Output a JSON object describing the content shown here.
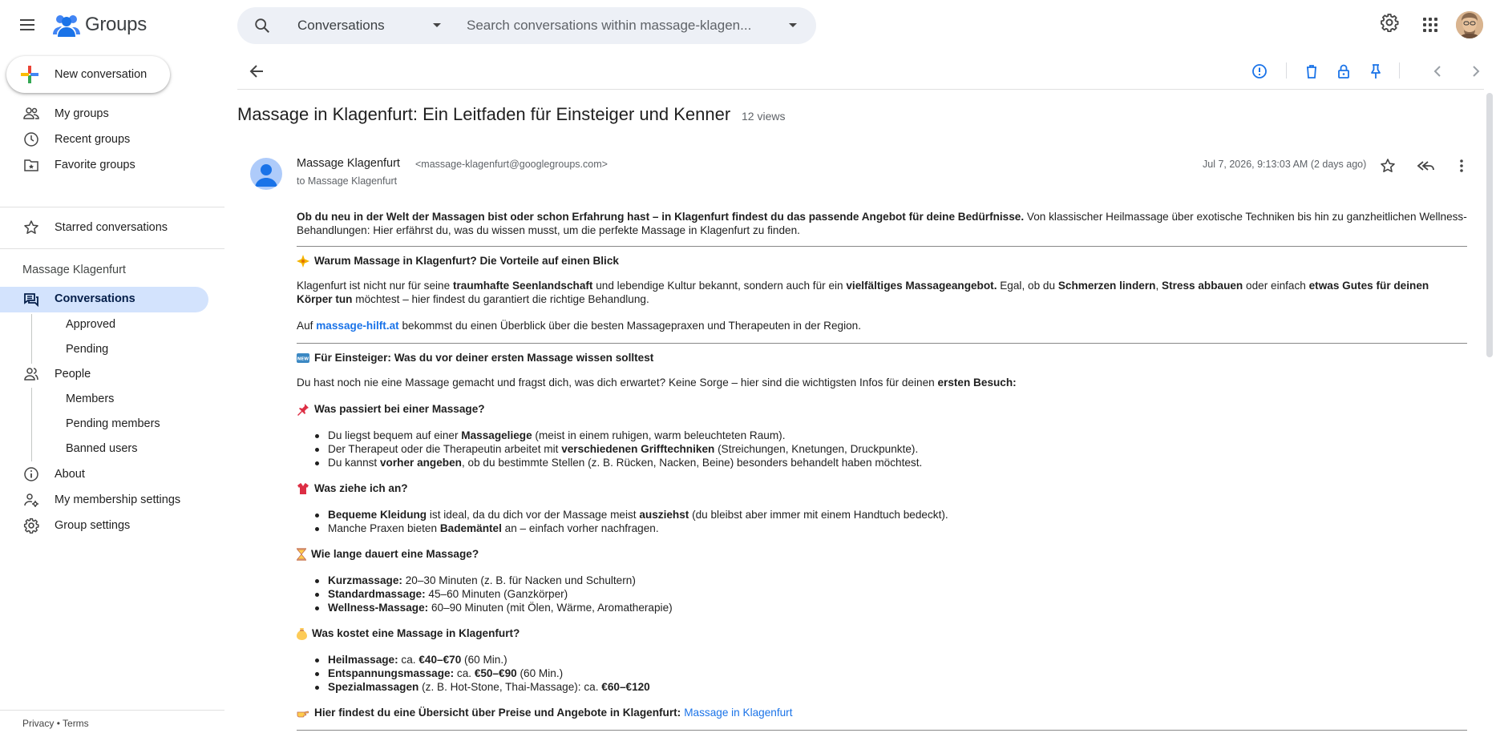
{
  "app": {
    "name": "Groups"
  },
  "search": {
    "scope": "Conversations",
    "placeholder": "Search conversations within massage-klagen..."
  },
  "sidebar": {
    "new_conversation": "New conversation",
    "top_items": [
      {
        "label": "My groups",
        "icon": "people-icon"
      },
      {
        "label": "Recent groups",
        "icon": "clock-icon"
      },
      {
        "label": "Favorite groups",
        "icon": "folder-star-icon"
      }
    ],
    "starred": "Starred conversations",
    "group_name": "Massage Klagenfurt",
    "conversations": "Conversations",
    "conversation_subitems": [
      "Approved",
      "Pending"
    ],
    "people": "People",
    "people_subitems": [
      "Members",
      "Pending members",
      "Banned users"
    ],
    "about": "About",
    "membership_settings": "My membership settings",
    "group_settings": "Group settings",
    "footer": {
      "privacy": "Privacy",
      "dot": "•",
      "terms": "Terms"
    }
  },
  "thread": {
    "title": "Massage in Klagenfurt: Ein Leitfaden für Einsteiger und Kenner",
    "views": "12 views",
    "sender_name": "Massage Klagenfurt",
    "sender_email": "<massage-klagenfurt@googlegroups.com>",
    "to": "to Massage Klagenfurt",
    "date": "Jul 7, 2026, 9:13:03 AM (2 days ago)"
  },
  "body": {
    "intro_bold": "Ob du neu in der Welt der Massagen bist oder schon Erfahrung hast – in Klagenfurt findest du das passende Angebot für deine Bedürfnisse.",
    "intro_rest": " Von klassischer Heilmassage über exotische Techniken bis hin zu ganzheitlichen Wellness-Behandlungen: Hier erfährst du, was du wissen musst, um die perfekte Massage in Klagenfurt zu finden.",
    "h1": "Warum Massage in Klagenfurt? Die Vorteile auf einen Blick",
    "p1_a": "Klagenfurt ist nicht nur für seine ",
    "p1_b": "traumhafte Seenlandschaft",
    "p1_c": " und lebendige Kultur bekannt, sondern auch für ein ",
    "p1_d": "vielfältiges Massageangebot.",
    "p1_e": " Egal, ob du ",
    "p1_f": "Schmerzen lindern",
    "p1_g": ", ",
    "p1_h": "Stress abbauen",
    "p1_i": " oder einfach ",
    "p1_j": "etwas Gutes für deinen Körper tun",
    "p1_k": " möchtest – hier findest du garantiert die richtige Behandlung.",
    "p2_a": "Auf ",
    "p2_link": "massage-hilft.at",
    "p2_b": " bekommst du einen Überblick über die besten Massagepraxen und Therapeuten in der Region.",
    "h2": "Für Einsteiger: Was du vor deiner ersten Massage wissen solltest",
    "p3_a": "Du hast noch nie eine Massage gemacht und fragst dich, was dich erwartet? Keine Sorge – hier sind die wichtigsten Infos für deinen ",
    "p3_b": "ersten Besuch:",
    "h3": "Was passiert bei einer Massage?",
    "l3": [
      {
        "a": "Du liegst bequem auf einer ",
        "b": "Massageliege",
        "c": " (meist in einem ruhigen, warm beleuchteten Raum)."
      },
      {
        "a": "Der Therapeut oder die Therapeutin arbeitet mit ",
        "b": "verschiedenen Grifftechniken",
        "c": " (Streichungen, Knetungen, Druckpunkte)."
      },
      {
        "a": "Du kannst ",
        "b": "vorher angeben",
        "c": ", ob du bestimmte Stellen (z. B. Rücken, Nacken, Beine) besonders behandelt haben möchtest."
      }
    ],
    "h4": "Was ziehe ich an?",
    "l4": [
      {
        "a": "",
        "b": "Bequeme Kleidung",
        "c": " ist ideal, da du dich vor der Massage meist ",
        "d": "ausziehst",
        "e": " (du bleibst aber immer mit einem Handtuch bedeckt)."
      },
      {
        "a": "Manche Praxen bieten ",
        "b": "Bademäntel",
        "c": " an – einfach vorher nachfragen.",
        "d": "",
        "e": ""
      }
    ],
    "h5": "Wie lange dauert eine Massage?",
    "l5": [
      {
        "b": "Kurzmassage:",
        "c": " 20–30 Minuten (z. B. für Nacken und Schultern)"
      },
      {
        "b": "Standardmassage:",
        "c": " 45–60 Minuten (Ganzkörper)"
      },
      {
        "b": "Wellness-Massage:",
        "c": " 60–90 Minuten (mit Ölen, Wärme, Aromatherapie)"
      }
    ],
    "h6": "Was kostet eine Massage in Klagenfurt?",
    "l6": [
      {
        "b": "Heilmassage:",
        "c": " ca. ",
        "d": "€40–€70",
        "e": " (60 Min.)"
      },
      {
        "b": "Entspannungsmassage:",
        "c": " ca. ",
        "d": "€50–€90",
        "e": " (60 Min.)"
      },
      {
        "b": "Spezialmassagen",
        "c": " (z. B. Hot-Stone, Thai-Massage): ca. ",
        "d": "€60–€120",
        "e": ""
      }
    ],
    "h7": "Hier findest du eine Übersicht über Preise und Angebote in Klagenfurt: ",
    "h7_link": "Massage in Klagenfurt"
  },
  "colors": {
    "accent": "#1a73e8",
    "active_bg": "#d3e3fd",
    "search_bg": "#edf0f6"
  }
}
